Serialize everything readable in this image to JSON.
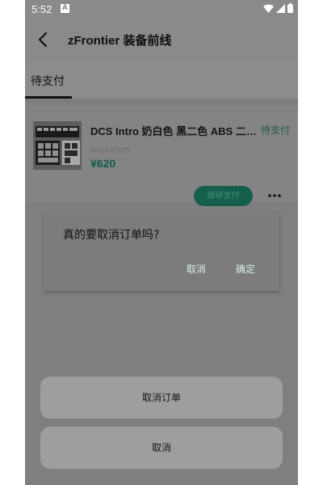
{
  "status_bar": {
    "time": "5:52",
    "notification_letter": "A",
    "icons": [
      "wifi-icon",
      "signal-icon",
      "battery-icon"
    ]
  },
  "app_bar": {
    "title": "zFrontier 装备前线",
    "back_icon": "back-arrow-icon"
  },
  "tabs": [
    {
      "label": "待支付",
      "selected": true
    }
  ],
  "order": {
    "title": "DCS Intro 奶白色 黑二色 ABS 二…",
    "status": "待支付",
    "variant": "Beige 奶白色",
    "price": "¥620",
    "pay_button_label": "继续支付",
    "more_icon": "more-dots-icon"
  },
  "dialog": {
    "message": "真的要取消订单吗?",
    "cancel_label": "取消",
    "confirm_label": "确定"
  },
  "bottom_sheet": {
    "cancel_order_label": "取消订单",
    "cancel_label": "取消"
  },
  "colors": {
    "accent": "#14604d",
    "price": "#0f5c4a",
    "dialog_action": "#d6ede6"
  }
}
